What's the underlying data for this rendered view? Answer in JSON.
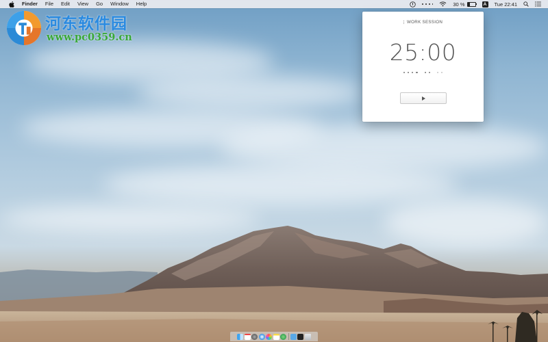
{
  "menubar": {
    "app_name": "Finder",
    "menus": [
      "File",
      "Edit",
      "View",
      "Go",
      "Window",
      "Help"
    ],
    "battery_percent": "30 %",
    "battery_level": 0.3,
    "input_source": "A",
    "clock": "Tue 22:41"
  },
  "watermark": {
    "title": "河东软件园",
    "url": "www.pc0359.cn"
  },
  "timer": {
    "session_label": "WORK SESSION",
    "time": "25:00",
    "sessions_completed": 0,
    "sessions_total": 8
  },
  "dock": {
    "icons": [
      "finder-icon",
      "calendar-icon",
      "launchpad-icon",
      "safari-icon",
      "photos-icon",
      "notes-icon",
      "maps-icon",
      "folder-icon",
      "terminal-icon",
      "trash-icon"
    ]
  },
  "colors": {
    "watermark_title": "#2a8ae0",
    "watermark_url": "#38a838",
    "timer_text": "#555555",
    "menubar_bg": "#ececf0"
  }
}
